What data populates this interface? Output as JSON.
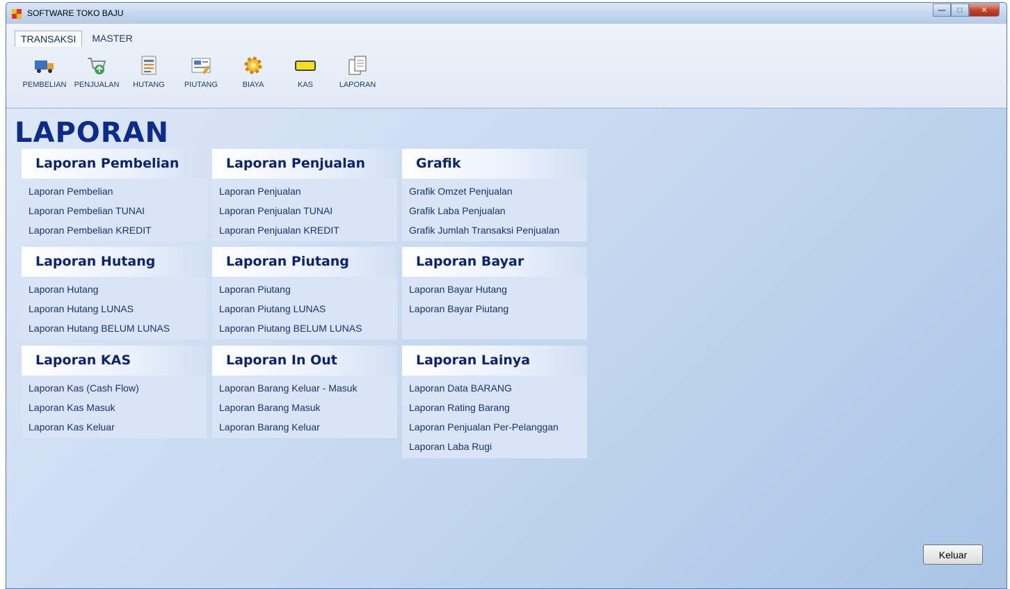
{
  "window": {
    "title": "SOFTWARE TOKO BAJU"
  },
  "ribbon": {
    "tabs": [
      {
        "label": "TRANSAKSI"
      },
      {
        "label": "MASTER"
      }
    ],
    "tools": [
      {
        "label": "PEMBELIAN",
        "icon": "truck-icon"
      },
      {
        "label": "PENJUALAN",
        "icon": "cart-icon"
      },
      {
        "label": "HUTANG",
        "icon": "ledger-icon"
      },
      {
        "label": "PIUTANG",
        "icon": "receivable-icon"
      },
      {
        "label": "BIAYA",
        "icon": "gear-icon"
      },
      {
        "label": "KAS",
        "icon": "cash-icon"
      },
      {
        "label": "LAPORAN",
        "icon": "report-icon"
      }
    ]
  },
  "main": {
    "title": "LAPORAN",
    "panels": [
      {
        "title": "Laporan Pembelian",
        "items": [
          "Laporan Pembelian",
          "Laporan Pembelian TUNAI",
          "Laporan Pembelian KREDIT"
        ]
      },
      {
        "title": "Laporan Penjualan",
        "items": [
          "Laporan Penjualan",
          "Laporan Penjualan TUNAI",
          "Laporan Penjualan KREDIT"
        ]
      },
      {
        "title": "Grafik",
        "items": [
          "Grafik Omzet Penjualan",
          "Grafik Laba Penjualan",
          "Grafik Jumlah Transaksi Penjualan"
        ]
      },
      {
        "title": "Laporan Hutang",
        "items": [
          "Laporan Hutang",
          "Laporan Hutang LUNAS",
          "Laporan Hutang BELUM LUNAS"
        ]
      },
      {
        "title": "Laporan Piutang",
        "items": [
          "Laporan Piutang",
          "Laporan Piutang LUNAS",
          "Laporan Piutang BELUM LUNAS"
        ]
      },
      {
        "title": "Laporan Bayar",
        "items": [
          "Laporan Bayar Hutang",
          "Laporan Bayar Piutang"
        ]
      },
      {
        "title": "Laporan KAS",
        "items": [
          "Laporan Kas (Cash Flow)",
          "Laporan Kas Masuk",
          "Laporan Kas Keluar"
        ]
      },
      {
        "title": "Laporan In Out",
        "items": [
          "Laporan Barang Keluar - Masuk",
          "Laporan Barang Masuk",
          "Laporan Barang Keluar"
        ]
      },
      {
        "title": "Laporan Lainya",
        "items": [
          "Laporan Data BARANG",
          "Laporan Rating Barang",
          "Laporan Penjualan Per-Pelanggan",
          "Laporan Laba Rugi"
        ]
      }
    ],
    "exit_label": "Keluar"
  }
}
